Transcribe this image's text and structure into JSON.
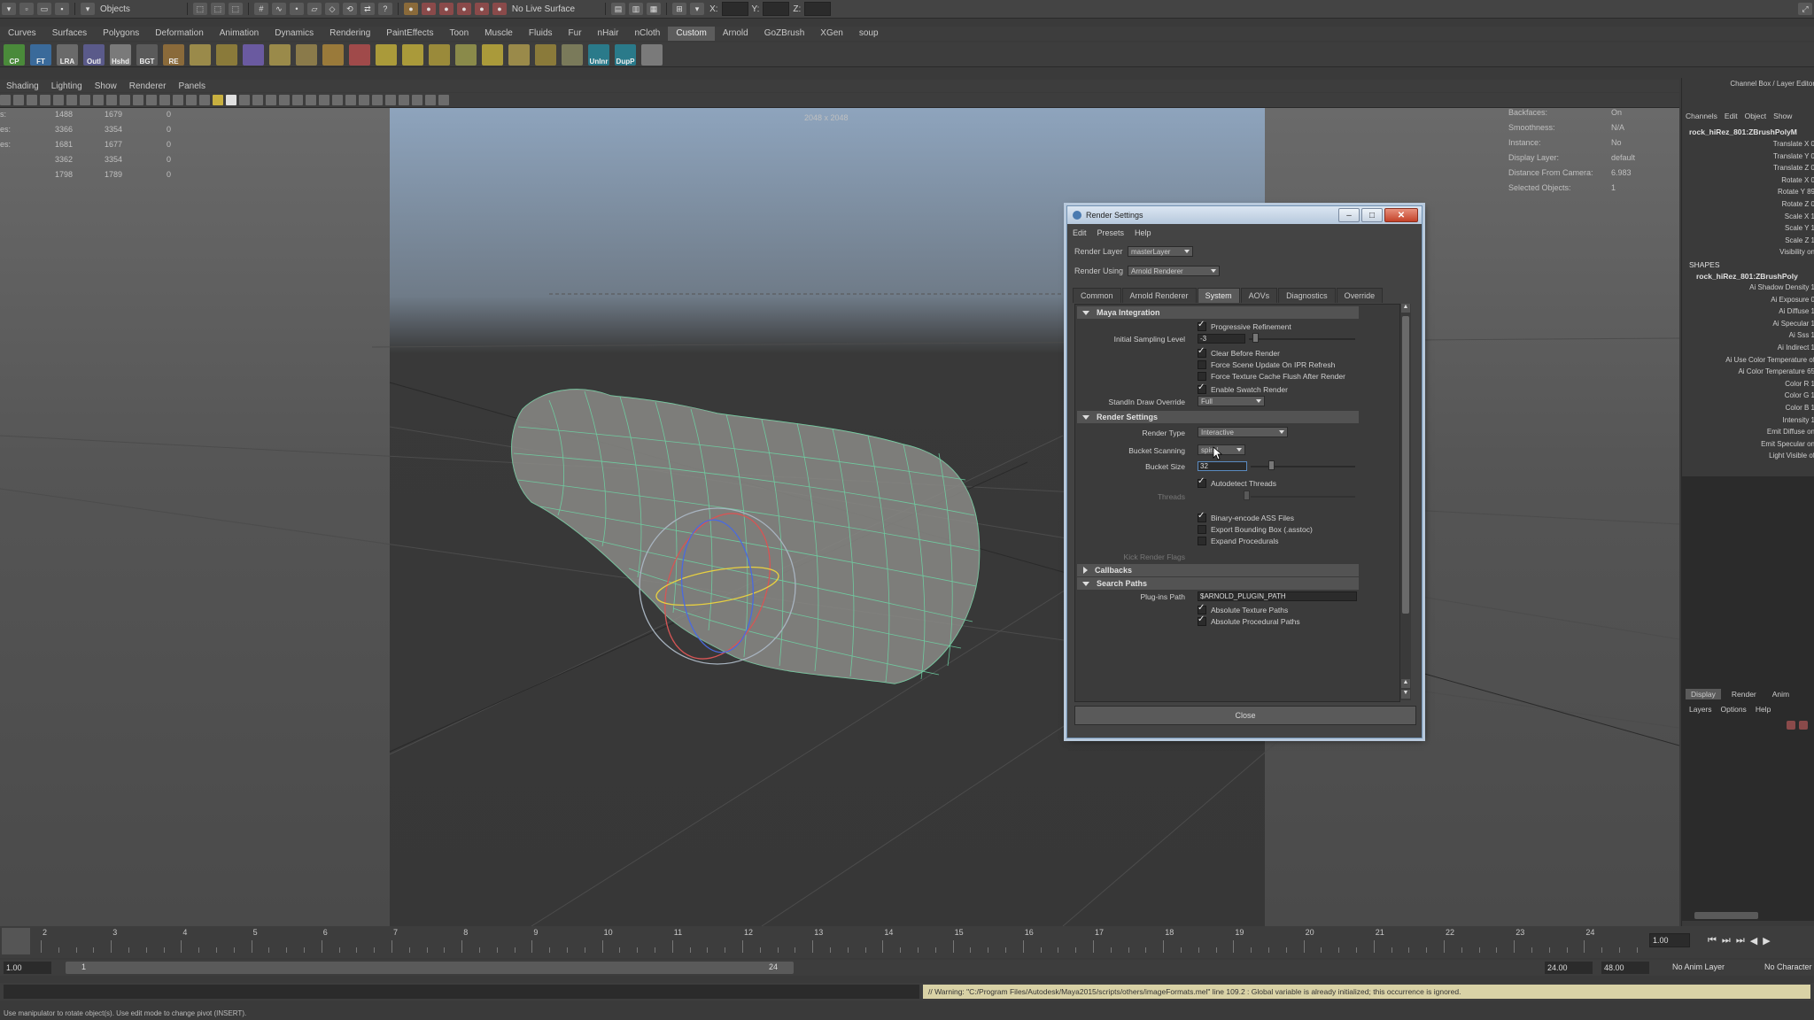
{
  "status_line": {
    "mode_label": "Objects",
    "live_surface_label": "No Live Surface",
    "x_label": "X:",
    "y_label": "Y:",
    "z_label": "Z:"
  },
  "shelf": {
    "tabs": [
      "Curves",
      "Surfaces",
      "Polygons",
      "Deformation",
      "Animation",
      "Dynamics",
      "Rendering",
      "PaintEffects",
      "Toon",
      "Muscle",
      "Fluids",
      "Fur",
      "nHair",
      "nCloth",
      "Custom",
      "Arnold",
      "GoZBrush",
      "XGen",
      "soup"
    ],
    "active_tab": "Custom",
    "icons": [
      {
        "label": "CP",
        "color": "#4a8a3a"
      },
      {
        "label": "FT",
        "color": "#3a6a9a"
      },
      {
        "label": "LRA",
        "color": "#6a6a6a"
      },
      {
        "label": "Outl",
        "color": "#5a5a8a"
      },
      {
        "label": "Hshd",
        "color": "#7a7a7a"
      },
      {
        "label": "BGT",
        "color": "#5a5a5a"
      },
      {
        "label": "RE",
        "color": "#8a6a3a"
      },
      {
        "label": "",
        "color": "#9a8a4a"
      },
      {
        "label": "",
        "color": "#8a7a3a"
      },
      {
        "label": "",
        "color": "#6a5aa0"
      },
      {
        "label": "",
        "color": "#9a8a4a"
      },
      {
        "label": "",
        "color": "#8a7a4a"
      },
      {
        "label": "",
        "color": "#9a7a3a"
      },
      {
        "label": "",
        "color": "#a04a4a"
      },
      {
        "label": "",
        "color": "#aa9a3a"
      },
      {
        "label": "",
        "color": "#aa9a3a"
      },
      {
        "label": "",
        "color": "#9a8a3a"
      },
      {
        "label": "",
        "color": "#8a8a4a"
      },
      {
        "label": "",
        "color": "#aa9a3a"
      },
      {
        "label": "",
        "color": "#9a8a4a"
      },
      {
        "label": "",
        "color": "#8a7a3a"
      },
      {
        "label": "",
        "color": "#7a7a5a"
      },
      {
        "label": "UnInr",
        "color": "#2a7a8a"
      },
      {
        "label": "DupP",
        "color": "#2a7a8a"
      },
      {
        "label": "",
        "color": "#7a7a7a"
      }
    ]
  },
  "viewport": {
    "panel_menu": [
      "Shading",
      "Lighting",
      "Show",
      "Renderer",
      "Panels"
    ],
    "resolution_label": "2048 x 2048",
    "hud_left": [
      [
        "1488",
        "1679",
        "0"
      ],
      [
        "3366",
        "3354",
        "0"
      ],
      [
        "1681",
        "1677",
        "0"
      ],
      [
        "3362",
        "3354",
        "0"
      ],
      [
        "1798",
        "1789",
        "0"
      ]
    ],
    "hud_left_labels": [
      "s:",
      "es:",
      "es:",
      "",
      ""
    ],
    "hud_right": [
      {
        "label": "Backfaces:",
        "value": "On"
      },
      {
        "label": "Smoothness:",
        "value": "N/A"
      },
      {
        "label": "Instance:",
        "value": "No"
      },
      {
        "label": "Display Layer:",
        "value": "default"
      },
      {
        "label": "Distance From Camera:",
        "value": "6.983"
      },
      {
        "label": "Selected Objects:",
        "value": "1"
      }
    ]
  },
  "dialog": {
    "title": "Render Settings",
    "menu": [
      "Edit",
      "Presets",
      "Help"
    ],
    "render_layer_label": "Render Layer",
    "render_layer_value": "masterLayer",
    "render_using_label": "Render Using",
    "render_using_value": "Arnold Renderer",
    "tabs": [
      "Common",
      "Arnold Renderer",
      "System",
      "AOVs",
      "Diagnostics",
      "Override"
    ],
    "active_tab": "System",
    "maya_integration": {
      "header": "Maya Integration",
      "progressive_refinement": "Progressive Refinement",
      "initial_sampling_label": "Initial Sampling Level",
      "initial_sampling_value": "-3",
      "clear_before_render": "Clear Before Render",
      "force_scene_update": "Force Scene Update On IPR Refresh",
      "force_texture_flush": "Force Texture Cache Flush After Render",
      "enable_swatch": "Enable Swatch Render",
      "standin_label": "StandIn Draw Override",
      "standin_value": "Full"
    },
    "render_settings": {
      "header": "Render Settings",
      "render_type_label": "Render Type",
      "render_type_value": "Interactive",
      "bucket_scanning_label": "Bucket Scanning",
      "bucket_scanning_value": "spiral",
      "bucket_size_label": "Bucket Size",
      "bucket_size_value": "32",
      "autodetect_threads": "Autodetect Threads",
      "threads_label": "Threads",
      "binary_ass": "Binary-encode ASS Files",
      "export_bbox": "Export Bounding Box (.asstoc)",
      "expand_procedurals": "Expand Procedurals",
      "kick_flags_label": "Kick Render Flags"
    },
    "callbacks_header": "Callbacks",
    "search_paths": {
      "header": "Search Paths",
      "plugins_label": "Plug-ins Path",
      "plugins_value": "$ARNOLD_PLUGIN_PATH",
      "abs_texture": "Absolute Texture Paths",
      "abs_procedural": "Absolute Procedural Paths"
    },
    "close_label": "Close"
  },
  "channel_box": {
    "header": "Channel Box / Layer Editor",
    "menu": [
      "Channels",
      "Edit",
      "Object",
      "Show"
    ],
    "object_name": "rock_hiRez_801:ZBrushPolyM",
    "attributes": [
      "Translate X 0",
      "Translate Y 0",
      "Translate Z 0",
      "Rotate X 0",
      "Rotate Y 89",
      "Rotate Z 0",
      "Scale X 1",
      "Scale Y 1",
      "Scale Z 1",
      "Visibility on"
    ],
    "shapes_label": "SHAPES",
    "shape_name": "rock_hiRez_801:ZBrushPoly",
    "shape_attributes": [
      "Ai Shadow Density 1",
      "Ai Exposure 0",
      "Ai Diffuse 1",
      "Ai Specular 1",
      "Ai Sss 1",
      "Ai Indirect 1",
      "Ai Use Color Temperature of",
      "Ai Color Temperature 65",
      "Color R 1",
      "Color G 1",
      "Color B 1",
      "Intensity 1",
      "Emit Diffuse on",
      "Emit Specular on",
      "Light Visible of"
    ],
    "layer_tabs": [
      "Display",
      "Render",
      "Anim"
    ],
    "active_layer_tab": "Display",
    "layer_menu": [
      "Layers",
      "Options",
      "Help"
    ]
  },
  "timeline": {
    "ticks": [
      "2",
      "3",
      "4",
      "5",
      "6",
      "7",
      "8",
      "9",
      "10",
      "11",
      "12",
      "13",
      "14",
      "15",
      "16",
      "17",
      "18",
      "19",
      "20",
      "21",
      "22",
      "23",
      "24"
    ],
    "current_frame": "1.00",
    "range_start": "1.00",
    "range_inner_start": "1",
    "range_inner_end": "24",
    "range_end": "24.00",
    "anim_end": "48.00",
    "anim_layer": "No Anim Layer",
    "character": "No Character"
  },
  "command_line": {
    "warning": "// Warning: \"C:/Program Files/Autodesk/Maya2015/scripts/others/imageFormats.mel\" line 109.2 : Global variable is already initialized; this occurrence is ignored."
  },
  "help_line": "Use manipulator to rotate object(s). Use edit mode to change pivot (INSERT)."
}
